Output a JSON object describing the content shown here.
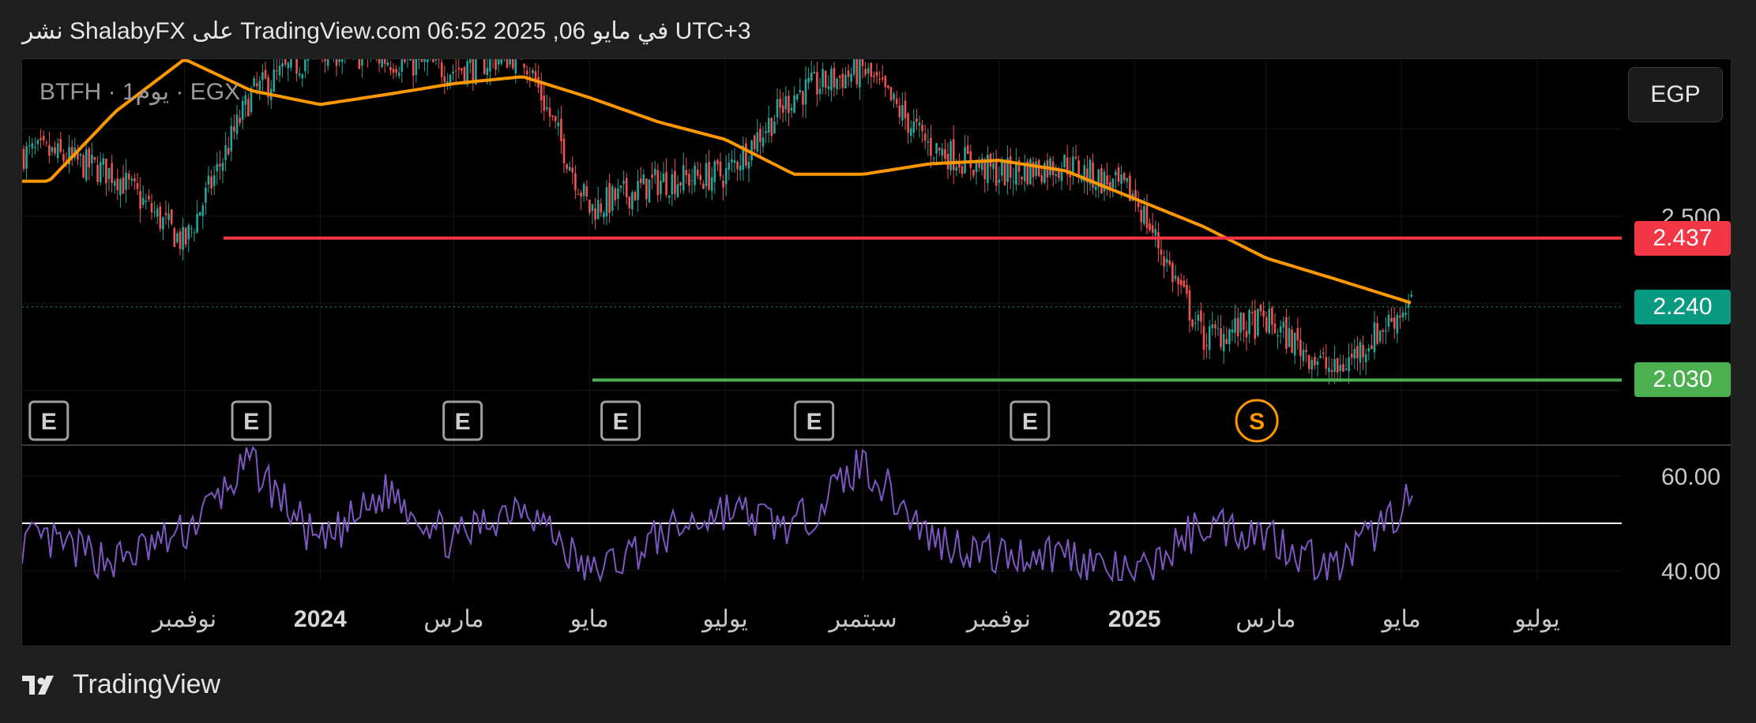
{
  "header": {
    "caption": "نشر ShalabyFX على TradingView.com 06:52 2025 ,06 في مايو UTC+3"
  },
  "chart_header": {
    "symbol": "BTFH · 1يوم · EGX",
    "currency_button": "EGP"
  },
  "footer": {
    "brand": "TradingView"
  },
  "colors": {
    "background": "#000000",
    "up_candle": "#26a69a",
    "down_candle": "#ef5350",
    "ma_line": "#ff9800",
    "resistance": "#f23645",
    "support": "#4caf50",
    "last_price": "#089981",
    "rsi_line": "#7e57c2",
    "rsi_midline": "#ffffff"
  },
  "chart_data": [
    {
      "type": "candlestick",
      "panel": "price",
      "ylim": [
        1.85,
        2.95
      ],
      "y_tick_labels": [
        "2.500"
      ],
      "x_tick_labels": [
        "نوفمبر",
        "2024",
        "مارس",
        "مايو",
        "يوليو",
        "سبتمبر",
        "نوفمبر",
        "2025",
        "مارس",
        "مايو",
        "يوليو"
      ],
      "series": [
        {
          "kind": "close",
          "x": [
            "2023-09-01",
            "2023-10-01",
            "2023-11-01",
            "2023-12-01",
            "2024-01-01",
            "2024-02-01",
            "2024-03-01",
            "2024-04-01",
            "2024-05-01",
            "2024-06-01",
            "2024-07-01",
            "2024-08-01",
            "2024-09-01",
            "2024-10-01",
            "2024-11-01",
            "2024-12-01",
            "2025-01-01",
            "2025-02-01",
            "2025-03-01",
            "2025-04-01",
            "2025-05-06"
          ],
          "values": [
            2.68,
            2.62,
            2.42,
            2.85,
            2.98,
            2.95,
            2.92,
            2.97,
            2.52,
            2.6,
            2.62,
            2.85,
            2.92,
            2.7,
            2.62,
            2.65,
            2.56,
            2.15,
            2.2,
            2.05,
            2.26
          ]
        },
        {
          "kind": "moving_average",
          "x": [
            "2023-09-01",
            "2023-10-01",
            "2023-11-01",
            "2023-12-01",
            "2024-01-01",
            "2024-02-01",
            "2024-03-01",
            "2024-04-01",
            "2024-05-01",
            "2024-06-01",
            "2024-07-01",
            "2024-08-01",
            "2024-09-01",
            "2024-10-01",
            "2024-11-01",
            "2024-12-01",
            "2025-01-01",
            "2025-02-01",
            "2025-03-01",
            "2025-04-01",
            "2025-05-06"
          ],
          "values": [
            2.6,
            2.8,
            2.95,
            2.86,
            2.82,
            2.85,
            2.88,
            2.9,
            2.84,
            2.77,
            2.72,
            2.62,
            2.62,
            2.65,
            2.66,
            2.63,
            2.55,
            2.47,
            2.38,
            2.32,
            2.25
          ]
        }
      ],
      "horizontal_lines": [
        {
          "name": "resistance",
          "value": 2.437,
          "label": "2.437"
        },
        {
          "name": "support",
          "value": 2.03,
          "label": "2.030"
        },
        {
          "name": "last_price",
          "value": 2.24,
          "label": "2.240"
        }
      ],
      "event_markers": [
        {
          "x": "2023-09-01",
          "label": "E"
        },
        {
          "x": "2023-12-01",
          "label": "E"
        },
        {
          "x": "2024-03-05",
          "label": "E"
        },
        {
          "x": "2024-05-15",
          "label": "E"
        },
        {
          "x": "2024-08-10",
          "label": "E"
        },
        {
          "x": "2024-11-15",
          "label": "E"
        },
        {
          "x": "2025-02-25",
          "label": "S"
        }
      ]
    },
    {
      "type": "line",
      "panel": "rsi",
      "ylim": [
        38,
        66
      ],
      "y_tick_labels": [
        "60.00",
        "40.00"
      ],
      "midline": 50,
      "series": [
        {
          "x": [
            "2023-09-01",
            "2023-10-01",
            "2023-11-01",
            "2023-12-01",
            "2024-01-01",
            "2024-02-01",
            "2024-03-01",
            "2024-04-01",
            "2024-05-01",
            "2024-06-01",
            "2024-07-01",
            "2024-08-01",
            "2024-09-01",
            "2024-10-01",
            "2024-11-01",
            "2024-12-01",
            "2025-01-01",
            "2025-02-01",
            "2025-03-01",
            "2025-04-01",
            "2025-05-06"
          ],
          "values": [
            46,
            42,
            48,
            63,
            45,
            57,
            46,
            55,
            39,
            47,
            53,
            49,
            63,
            47,
            43,
            44,
            38,
            50,
            48,
            40,
            56
          ]
        }
      ]
    }
  ]
}
